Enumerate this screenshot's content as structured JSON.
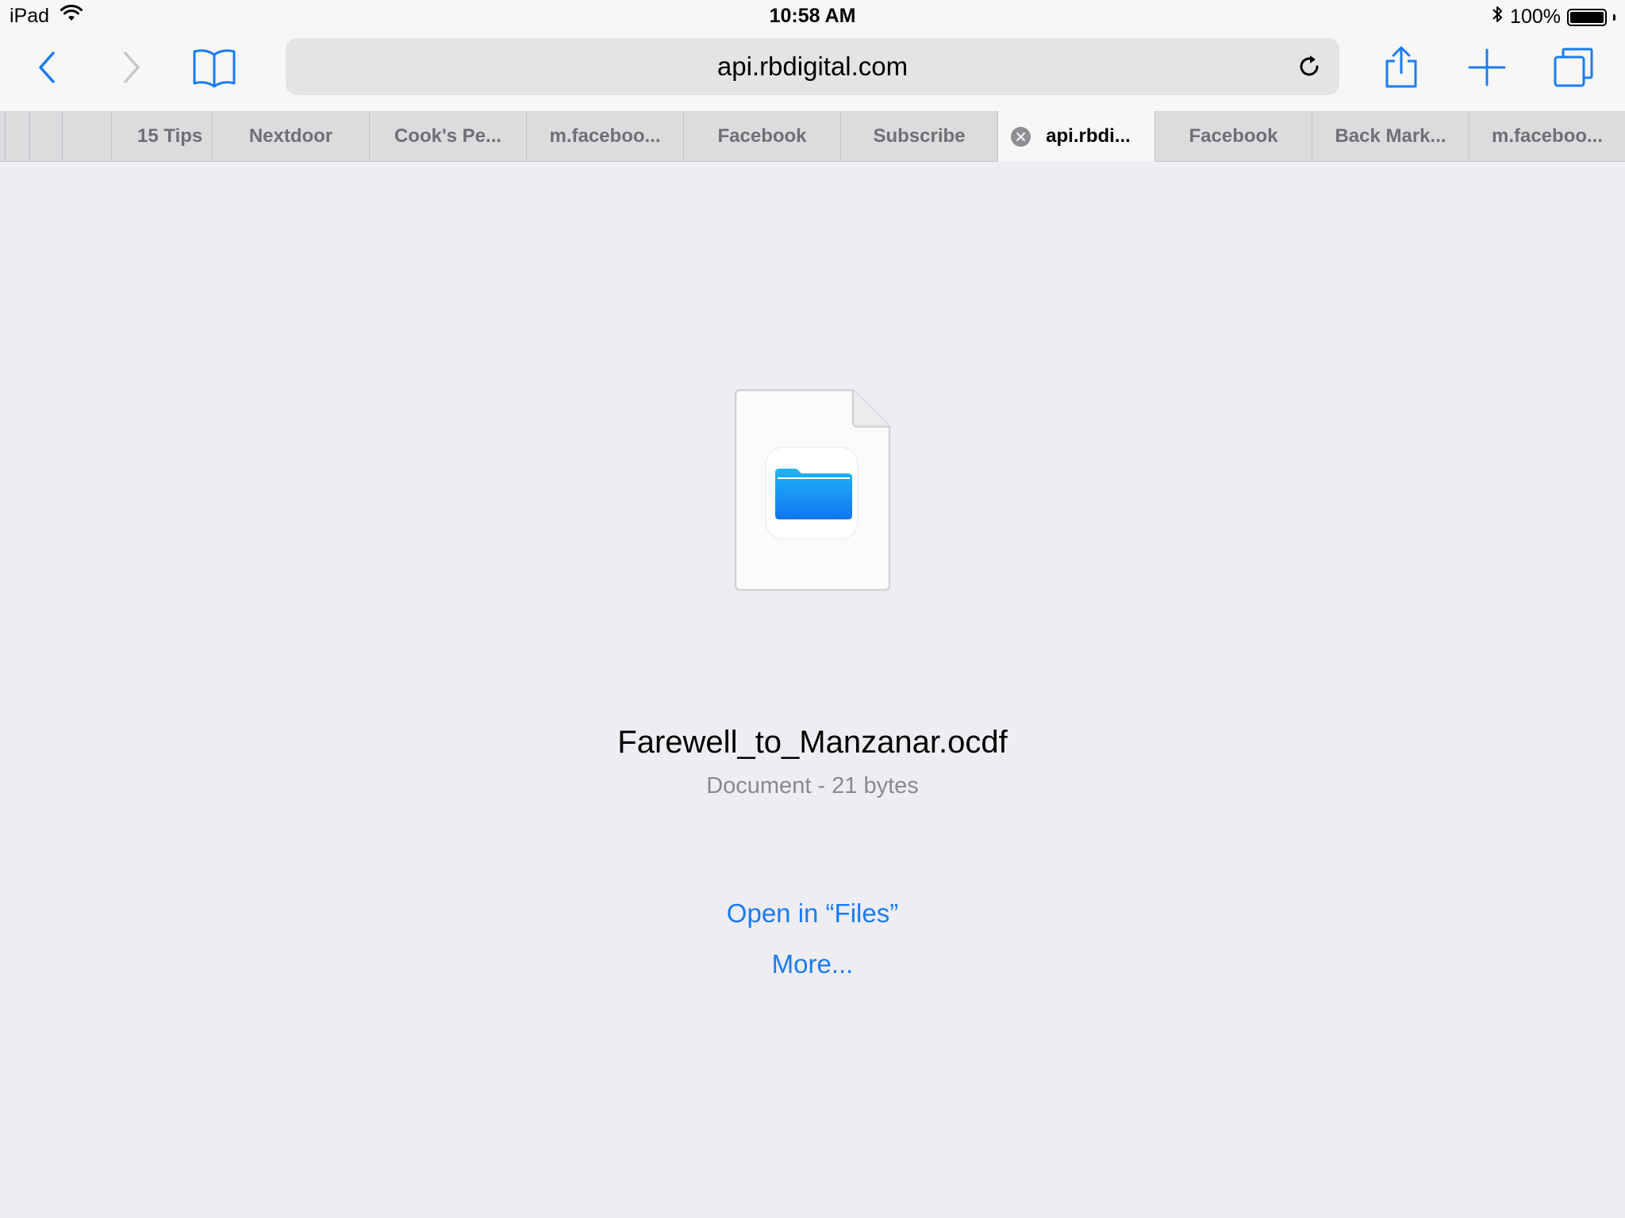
{
  "status_bar": {
    "device": "iPad",
    "time": "10:58 AM",
    "battery_percent": "100%",
    "battery_level": 1.0
  },
  "toolbar": {
    "back_icon": "chevron-left-icon",
    "forward_icon": "chevron-right-icon",
    "bookmarks_icon": "book-icon",
    "address": "api.rbdigital.com",
    "reload_icon": "reload-icon",
    "share_icon": "share-icon",
    "new_tab_icon": "plus-icon",
    "tabs_icon": "tabs-icon"
  },
  "tabs": [
    {
      "label": "15 Tips"
    },
    {
      "label": "Nextdoor"
    },
    {
      "label": "Cook's Pe..."
    },
    {
      "label": "m.faceboo..."
    },
    {
      "label": "Facebook"
    },
    {
      "label": "Subscribe"
    },
    {
      "label": "api.rbdi...",
      "active": true
    },
    {
      "label": "Facebook"
    },
    {
      "label": "Back Mark..."
    },
    {
      "label": "m.faceboo..."
    }
  ],
  "document": {
    "file_name": "Farewell_to_Manzanar.ocdf",
    "meta": "Document - 21 bytes",
    "icon": "folder-icon"
  },
  "actions": {
    "open_in_files": "Open in “Files”",
    "more": "More..."
  },
  "colors": {
    "accent": "#1A7CF2",
    "background": "#EEEDF2",
    "toolbar": "#F7F7F7",
    "tab_bar": "#DCDCDF"
  }
}
